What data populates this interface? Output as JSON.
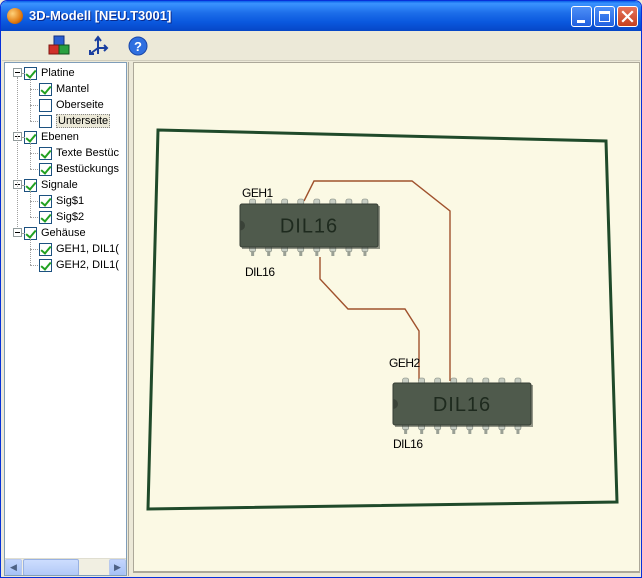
{
  "window": {
    "title": "3D-Modell  [NEU.T3001]"
  },
  "toolbar": {
    "buttons": [
      {
        "icon": "colored-blocks-icon",
        "tooltip": ""
      },
      {
        "icon": "axis-arrows-icon",
        "tooltip": ""
      },
      {
        "icon": "help-icon",
        "tooltip": ""
      }
    ]
  },
  "tree": {
    "groups": [
      {
        "label": "Platine",
        "checked": true,
        "expanded": true,
        "children": [
          {
            "label": "Mantel",
            "checked": true
          },
          {
            "label": "Oberseite",
            "checked": false
          },
          {
            "label": "Unterseite",
            "checked": false,
            "selected": true
          }
        ]
      },
      {
        "label": "Ebenen",
        "checked": true,
        "expanded": true,
        "children": [
          {
            "label": "Texte Bestüc",
            "checked": true
          },
          {
            "label": "Bestückungs",
            "checked": true
          }
        ]
      },
      {
        "label": "Signale",
        "checked": true,
        "expanded": true,
        "children": [
          {
            "label": "Sig$1",
            "checked": true
          },
          {
            "label": "Sig$2",
            "checked": true
          }
        ]
      },
      {
        "label": "Gehäuse",
        "checked": true,
        "expanded": true,
        "children": [
          {
            "label": "GEH1, DIL1(",
            "checked": true
          },
          {
            "label": "GEH2, DIL1(",
            "checked": true
          }
        ]
      }
    ]
  },
  "board": {
    "components": [
      {
        "ref": "GEH1",
        "package": "DIL16",
        "body_text": "DIL16"
      },
      {
        "ref": "GEH2",
        "package": "DIL16",
        "body_text": "DIL16"
      }
    ],
    "colors": {
      "background": "#fbf9e4",
      "outline": "#1f4a2a",
      "trace": "#a0522d",
      "chip_body": "#4f5a4c",
      "chip_text": "#1e2a1e",
      "pin": "#c8cec4"
    }
  }
}
